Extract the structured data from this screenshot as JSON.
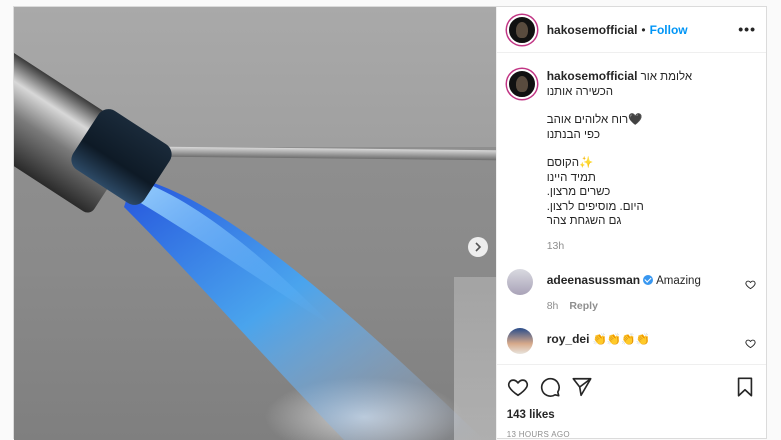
{
  "post": {
    "username": "hakosemofficial",
    "follow_label": "Follow",
    "more_label": "•••",
    "caption_lines": [
      "אלומת אור",
      "הכשירה אותנו",
      "",
      "רוח אלוהים אוהב🖤",
      "כפי הבנתנו",
      "",
      "הקוסם✨",
      "תמיד היינו",
      ".כשרים מרצון",
      ".היום. מוסיפים לרצון",
      "גם השגחת צהר"
    ],
    "caption_time": "13h",
    "likes": "143 likes",
    "posted_ago": "13 HOURS AGO"
  },
  "comments": [
    {
      "username": "adeenasussman",
      "verified": true,
      "text": "Amazing",
      "time": "8h",
      "reply_label": "Reply"
    },
    {
      "username": "roy_dei",
      "verified": false,
      "text": "👏👏👏👏"
    }
  ],
  "icons": {
    "next": "chevron-right-icon",
    "like": "heart-outline-icon",
    "comment": "comment-bubble-icon",
    "share": "paper-plane-icon",
    "save": "bookmark-icon"
  },
  "colors": {
    "accent": "#0095f6",
    "verified": "#3897f0",
    "muted": "#8e8e8e",
    "flame": "#3fa9ff"
  }
}
